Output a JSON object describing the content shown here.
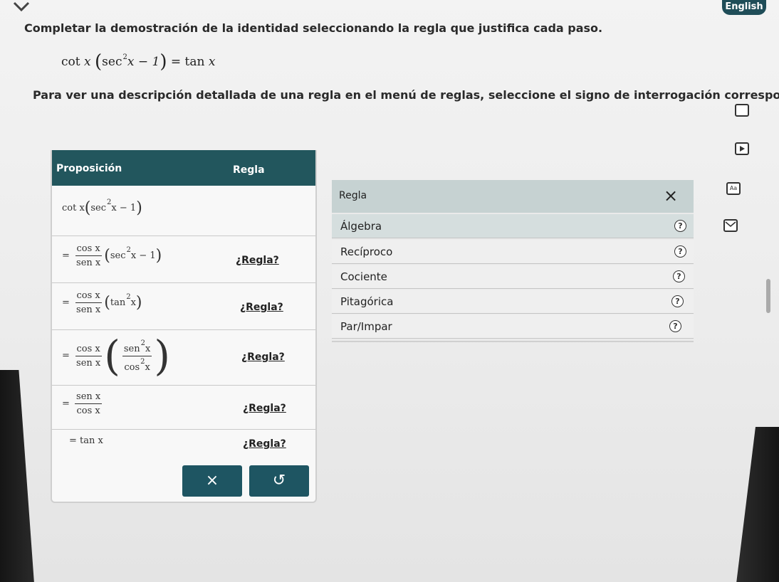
{
  "topbar": {
    "language_label": "English"
  },
  "instructions": {
    "main": "Completar la demostración de la identidad seleccionando la regla que justifica cada paso.",
    "detail": "Para ver una descripción detallada de una regla en el menú de reglas, seleccione el signo de interrogación correspondiente."
  },
  "identity": {
    "lhs_fn": "cot",
    "var": "x",
    "sec": "sec",
    "sup": "2",
    "minus_one": "x − 1",
    "rhs": "= tan",
    "rhs_var": "x"
  },
  "proof_table": {
    "header_prop": "Proposición",
    "header_rule": "Regla",
    "rule_placeholder": "¿Regla?",
    "r1": {
      "fn": "cot x",
      "sec": "sec",
      "sup": "2",
      "tail": "x − 1"
    },
    "r2": {
      "eq": "=",
      "num": "cos x",
      "den": "sen x",
      "sec": "sec",
      "sup": "2",
      "tail": "x − 1"
    },
    "r3": {
      "eq": "=",
      "num": "cos x",
      "den": "sen x",
      "tan": "tan",
      "sup": "2",
      "tail": "x"
    },
    "r4": {
      "eq": "=",
      "num": "cos x",
      "den": "sen x",
      "in_num": "sen",
      "in_den": "cos",
      "sup": "2",
      "var": "x"
    },
    "r5": {
      "eq": "=",
      "num": "sen x",
      "den": "cos x"
    },
    "r6": {
      "text": "= tan x"
    },
    "clear_icon": "×",
    "undo_icon": "↺"
  },
  "rules_panel": {
    "title": "Regla",
    "close_icon": "×",
    "help_icon": "?",
    "items": [
      {
        "label": "Álgebra"
      },
      {
        "label": "Recíproco"
      },
      {
        "label": "Cociente"
      },
      {
        "label": "Pitagórica"
      },
      {
        "label": "Par/Impar"
      }
    ]
  },
  "side_icons": {
    "text_size": "Aa"
  }
}
